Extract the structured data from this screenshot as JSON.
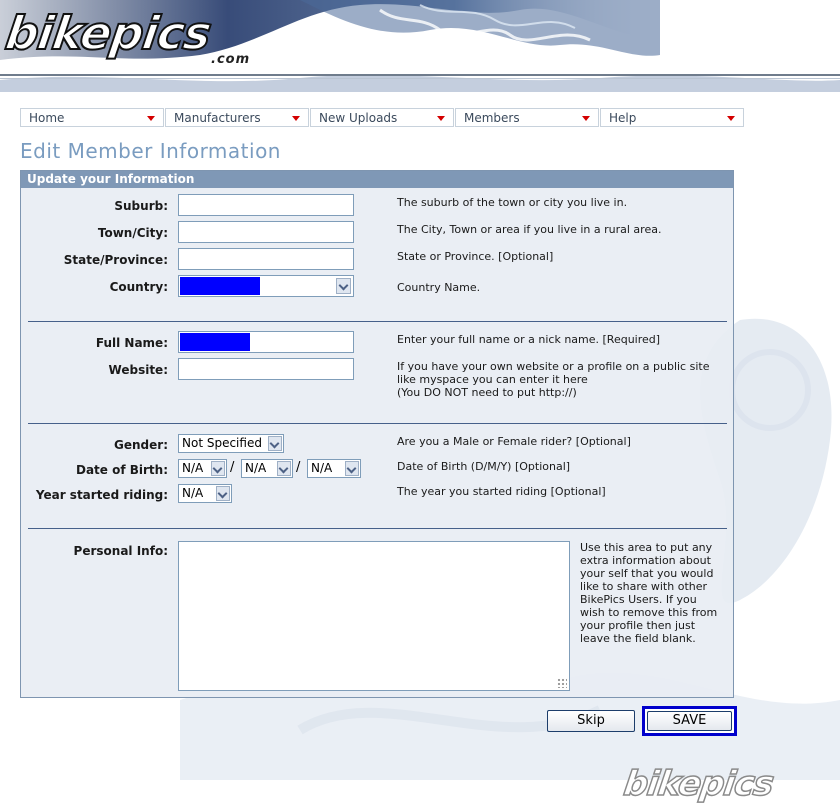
{
  "header": {
    "logo_text": "bikepics",
    "logo_suffix": ".com"
  },
  "nav": {
    "items": [
      {
        "label": "Home"
      },
      {
        "label": "Manufacturers"
      },
      {
        "label": "New Uploads"
      },
      {
        "label": "Members"
      },
      {
        "label": "Help"
      }
    ]
  },
  "page": {
    "title": "Edit Member Information"
  },
  "panel": {
    "heading": "Update your Information"
  },
  "form": {
    "suburb": {
      "label": "Suburb:",
      "value": "",
      "hint": "The suburb of the town or city you live in."
    },
    "town": {
      "label": "Town/City:",
      "value": "",
      "hint": "The City, Town or area if you live in a rural area."
    },
    "state": {
      "label": "State/Province:",
      "value": "",
      "hint": "State or Province. [Optional]"
    },
    "country": {
      "label": "Country:",
      "value": "",
      "hint": "Country Name."
    },
    "fullname": {
      "label": "Full Name:",
      "value": "",
      "hint": "Enter your full name or a nick name. [Required]"
    },
    "website": {
      "label": "Website:",
      "value": "",
      "hint_line1": "If you have your own website or a profile on a public site",
      "hint_line2": "like myspace you can enter it here",
      "hint_line3": "(You DO NOT need to put http://)"
    },
    "gender": {
      "label": "Gender:",
      "value": "Not Specified",
      "hint": "Are you a Male or Female rider? [Optional]"
    },
    "dob": {
      "label": "Date of Birth:",
      "day": "N/A",
      "month": "N/A",
      "year": "N/A",
      "separator": "/",
      "hint": "Date of Birth (D/M/Y) [Optional]"
    },
    "year_started": {
      "label": "Year started riding:",
      "value": "N/A",
      "hint": "The year you started riding [Optional]"
    },
    "personal_info": {
      "label": "Personal Info:",
      "value": "",
      "hint_lines": [
        "Use this area to put any",
        "extra information about",
        "your self that you would",
        "like to share with other",
        "BikePics Users. If you",
        "wish to remove this from",
        "your profile then just",
        "leave the field blank."
      ]
    }
  },
  "actions": {
    "skip_label": "Skip",
    "save_label": "SAVE"
  },
  "footer": {
    "logo_text": "bikepics"
  },
  "colors": {
    "panel_header": "#7f98b6",
    "title": "#7a9cc0",
    "nav_arrow": "#d40000",
    "highlight": "#0000ff"
  }
}
